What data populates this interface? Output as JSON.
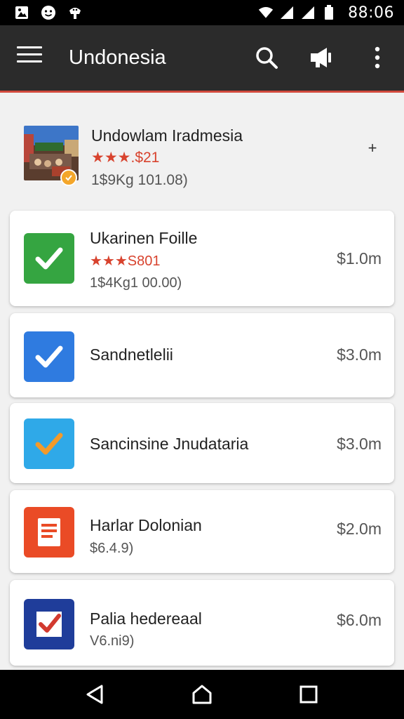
{
  "status_bar": {
    "time": "88:06",
    "icons": [
      "image-icon",
      "smiley-icon",
      "android-debug-icon",
      "wifi-icon",
      "signal-icon",
      "signal-icon-2",
      "battery-icon"
    ]
  },
  "app_bar": {
    "title": "Undonesia",
    "actions": [
      "search-icon",
      "megaphone-icon",
      "more-vert-icon"
    ]
  },
  "featured": {
    "title": "Undowlam Iradmesia",
    "rating_text": "★★★.$21",
    "meta": "1$9Kg 101.08)",
    "plus": "+"
  },
  "items": [
    {
      "title": "Ukarinen Foille",
      "rating_text": "★★★S801",
      "meta": "1$4Kg1 00.00)",
      "price": "$1.0m",
      "icon": "green-check-icon",
      "color": "#35a541"
    },
    {
      "title": "Sandnetlelii",
      "rating_text": "",
      "meta": "",
      "price": "$3.0m",
      "icon": "blue-check-icon",
      "color": "#2f7be0"
    },
    {
      "title": "Sancinsine Jnudataria",
      "rating_text": "",
      "meta": "",
      "price": "$3.0m",
      "icon": "lightblue-orange-check-icon",
      "color": "#2fa9e8"
    },
    {
      "title": "Harlar Dolonian",
      "rating_text": "",
      "meta": "$6.4.9)",
      "price": "$2.0m",
      "icon": "document-icon",
      "color": "#ea4b26"
    },
    {
      "title": "Palia hedereaal",
      "rating_text": "",
      "meta": "V6.ni9)",
      "price": "$6.0m",
      "icon": "navy-check-icon",
      "color": "#1f3d9a"
    }
  ],
  "nav": [
    "back-icon",
    "home-icon",
    "recents-icon"
  ]
}
